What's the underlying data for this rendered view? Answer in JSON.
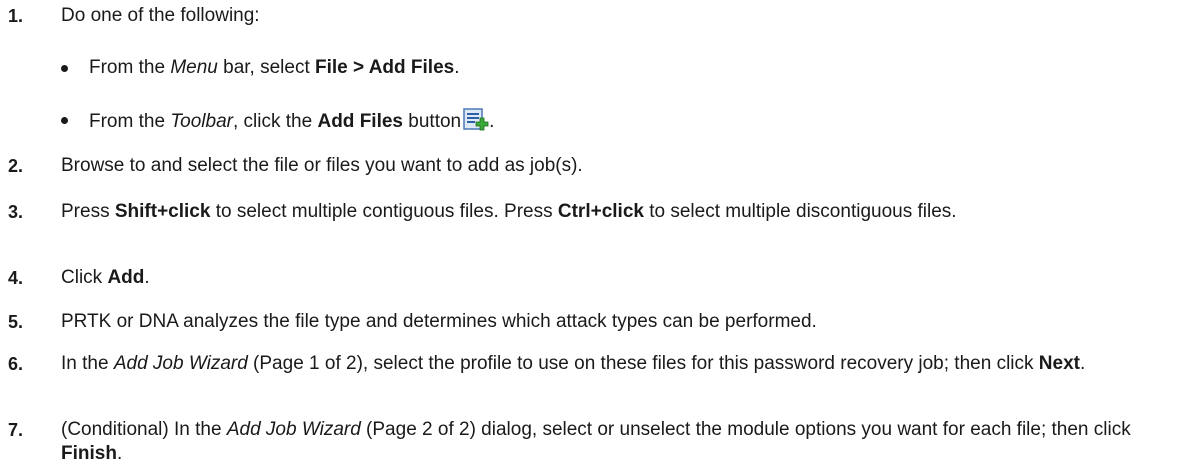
{
  "steps": [
    {
      "num": "1.",
      "text": "Do one of the following:"
    },
    {
      "num": "2.",
      "text": "Browse to and select the file or files you want to add as job(s)."
    },
    {
      "num": "3.",
      "pre": "Press ",
      "b1": "Shift+click",
      "mid": " to select multiple contiguous files. Press ",
      "b2": "Ctrl+click",
      "post": " to select multiple discontiguous files."
    },
    {
      "num": "4.",
      "pre": "Click ",
      "b1": "Add",
      "post": "."
    },
    {
      "num": "5.",
      "text": "PRTK or DNA analyzes the file type and determines which attack types can be performed."
    },
    {
      "num": "6.",
      "pre": "In the ",
      "i1": "Add Job Wizard",
      "mid": " (Page 1 of 2), select the profile to use on these files for this password recovery job; then click ",
      "b1": "Next",
      "post": "."
    },
    {
      "num": "7.",
      "pre": "(Conditional) In the ",
      "i1": "Add Job Wizard",
      "mid": " (Page 2 of 2) dialog, select or unselect the module options you want for each file; then click ",
      "b1": "Finish",
      "post": "."
    }
  ],
  "sub_steps": [
    {
      "pre": "From the ",
      "i1": "Menu",
      "mid": " bar, select ",
      "b1": "File > Add Files",
      "post": "."
    },
    {
      "pre": "From the ",
      "i1": "Toolbar",
      "mid": ", click the ",
      "b1": "Add Files",
      "post": " button",
      "end": ".",
      "icon": "add-files-icon"
    }
  ]
}
